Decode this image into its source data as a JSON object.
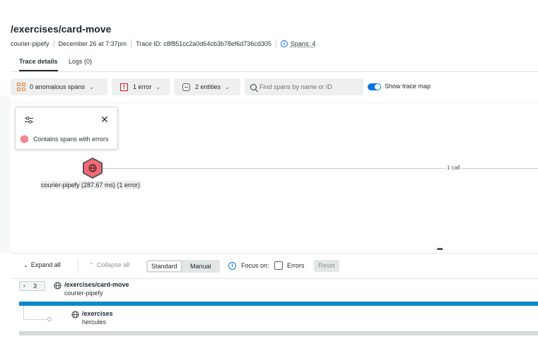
{
  "header": {
    "title": "/exercises/card-move",
    "service": "courier-pipefy",
    "timestamp": "December 26 at 7:37pm",
    "trace_id": "Trace ID: c8f851cc2a0d64cb3b78ef6d736cd305",
    "spans_link": "Spans: 4"
  },
  "tabs": [
    {
      "label": "Trace details"
    },
    {
      "label": "Logs (0)"
    }
  ],
  "filters": {
    "anomalous": "0 anomalous spans",
    "errors": "1 error",
    "entities": "2 entities",
    "search_placeholder": "Find spans by name or ID",
    "show_trace_map": "Show trace map"
  },
  "legend": {
    "item": "Contains spans with errors"
  },
  "map": {
    "call_label": "1 call",
    "node_label": "courier-pipefy (287.67 ms) (1 error)"
  },
  "toolbar": {
    "expand_all": "Expand all",
    "collapse_all": "Collapse all",
    "view_standard": "Standard",
    "view_manual": "Manual",
    "focus_on": "Focus on:",
    "errors": "Errors",
    "reset": "Reset"
  },
  "spans": [
    {
      "count": "3",
      "name": "/exercises/card-move",
      "service": "courier-pipefy"
    },
    {
      "name": "/exercises",
      "service": "hercules"
    }
  ],
  "colors": {
    "accent": "#0c74df",
    "error": "#f06a78",
    "span_bar": "#0c8ac8"
  }
}
